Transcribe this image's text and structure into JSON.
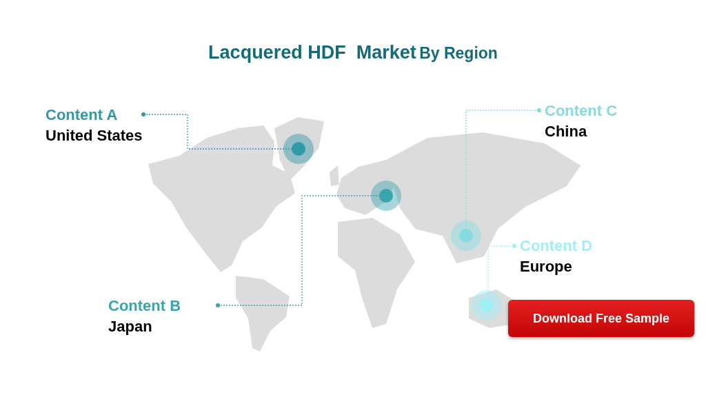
{
  "title": {
    "main": "Lacquered HDF  Market",
    "suffix": "By Region"
  },
  "callouts": [
    {
      "heading": "Content A",
      "region": "United States",
      "color": "#2f9aa6"
    },
    {
      "heading": "Content B",
      "region": "Japan",
      "color": "#3aa3ab"
    },
    {
      "heading": "Content C",
      "region": "China",
      "color": "#86dbe3"
    },
    {
      "heading": "Content D",
      "region": "Europe",
      "color": "#9eeff6"
    }
  ],
  "button": {
    "label": "Download Free Sample"
  }
}
